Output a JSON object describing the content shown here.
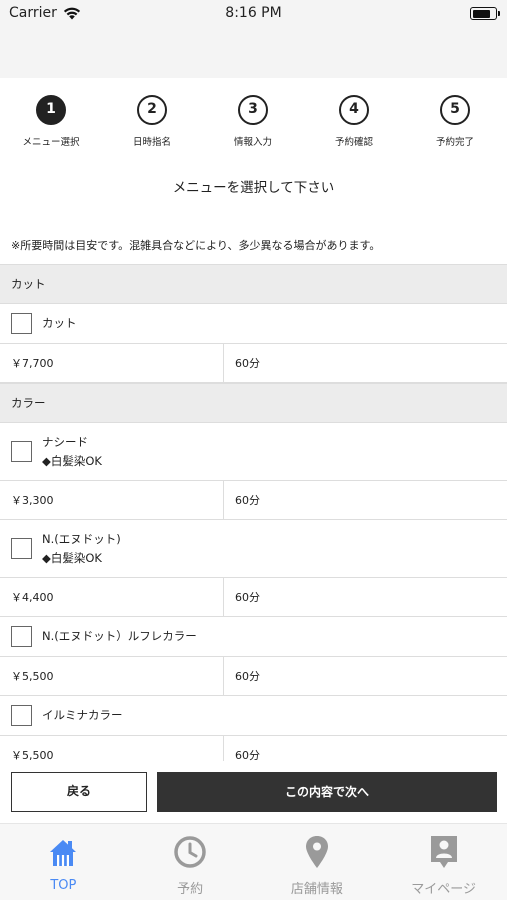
{
  "status_bar": {
    "carrier": "Carrier",
    "time": "8:16 PM"
  },
  "steps": [
    {
      "number": "1",
      "label": "メニュー選択"
    },
    {
      "number": "2",
      "label": "日時指名"
    },
    {
      "number": "3",
      "label": "情報入力"
    },
    {
      "number": "4",
      "label": "予約確認"
    },
    {
      "number": "5",
      "label": "予約完了"
    }
  ],
  "instruction": "メニューを選択して下さい",
  "notice": "※所要時間は目安です。混雑具合などにより、多少異なる場合があります。",
  "categories": [
    {
      "name": "カット",
      "items": [
        {
          "name": "カット",
          "note": "",
          "price": "￥7,700",
          "duration": "60分"
        }
      ]
    },
    {
      "name": "カラー",
      "items": [
        {
          "name": "ナシード",
          "note": "◆白髪染OK",
          "price": "￥3,300",
          "duration": "60分"
        },
        {
          "name": "N.(エヌドット)",
          "note": "◆白髪染OK",
          "price": "￥4,400",
          "duration": "60分"
        },
        {
          "name": "N.(エヌドット）ルフレカラー",
          "note": "",
          "price": "￥5,500",
          "duration": "60分"
        },
        {
          "name": "イルミナカラー",
          "note": "",
          "price": "￥5,500",
          "duration": "60分"
        }
      ]
    }
  ],
  "actions": {
    "back_label": "戻る",
    "next_label": "この内容で次へ"
  },
  "tabs": [
    {
      "label": "TOP",
      "icon": "home-icon"
    },
    {
      "label": "予約",
      "icon": "clock-icon"
    },
    {
      "label": "店舗情報",
      "icon": "map-pin-icon"
    },
    {
      "label": "マイページ",
      "icon": "user-badge-icon"
    }
  ],
  "colors": {
    "active_tab": "#4a8af4",
    "inactive_tab": "#9a9a9a",
    "primary_button": "#333333",
    "category_bg": "#ececec"
  }
}
